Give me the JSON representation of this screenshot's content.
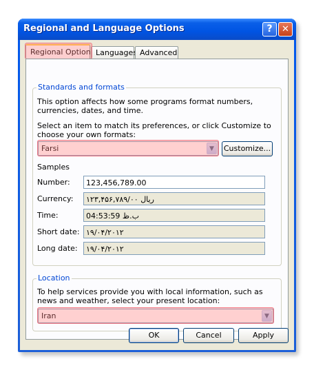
{
  "window": {
    "title": "Regional and Language Options",
    "help_glyph": "?",
    "close_glyph": "✕"
  },
  "tabs": [
    {
      "label": "Regional Options",
      "active": true
    },
    {
      "label": "Languages",
      "active": false
    },
    {
      "label": "Advanced",
      "active": false
    }
  ],
  "standards": {
    "group_label": "Standards and formats",
    "description": "This option affects how some programs format numbers, currencies, dates, and time.",
    "select_prompt": "Select an item to match its preferences, or click Customize to choose your own formats:",
    "selected_format": "Farsi",
    "customize_label": "Customize...",
    "samples_label": "Samples",
    "samples": [
      {
        "label": "Number:",
        "value": "123,456,789.00"
      },
      {
        "label": "Currency:",
        "value": "۱۲۳,۴۵۶,۷۸۹/۰۰ ریال"
      },
      {
        "label": "Time:",
        "value": "04:53:59 ب.ظ"
      },
      {
        "label": "Short date:",
        "value": "۱۹/۰۴/۲۰۱۲"
      },
      {
        "label": "Long date:",
        "value": "۱۹/۰۴/۲۰۱۲"
      }
    ]
  },
  "location": {
    "group_label": "Location",
    "description": "To help services provide you with local information, such as news and weather, select your present location:",
    "selected_location": "Iran"
  },
  "buttons": {
    "ok": "OK",
    "cancel": "Cancel",
    "apply": "Apply"
  },
  "colors": {
    "title_bar": "#0054e3",
    "group_label": "#0046d5",
    "highlight": "#f07a86",
    "dialog_bg": "#ece9d8"
  }
}
